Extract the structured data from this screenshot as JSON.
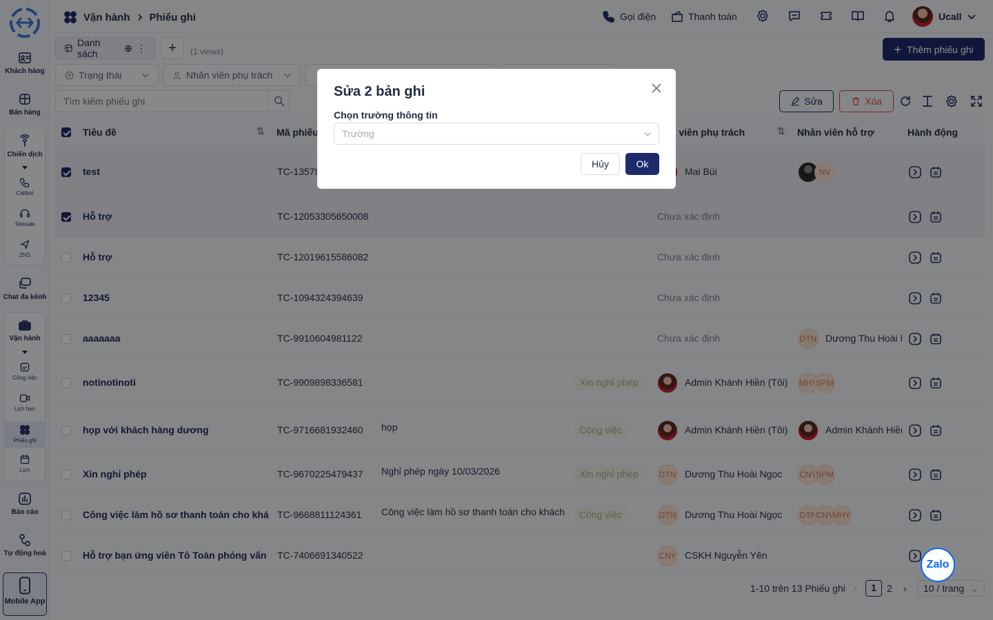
{
  "breadcrumb": {
    "section": "Vận hành",
    "page": "Phiếu ghi"
  },
  "topbar": {
    "call": "Gọi điện",
    "payment": "Thanh toán",
    "user": "Ucall"
  },
  "sidebar": {
    "customers": "Khách hàng",
    "sales": "Bán hàng",
    "campaign": "Chiến dịch",
    "callbot": "Callbot",
    "telesale": "Telesale",
    "zns": "ZNS",
    "chat": "Chat đa kênh",
    "operations": "Vận hành",
    "tasks": "Công việc",
    "appointments": "Lịch hẹn",
    "tickets": "Phiếu ghi",
    "calendar": "Lịch",
    "reports": "Báo cáo",
    "automation": "Tự động hoá",
    "mobile": "Mobile App"
  },
  "toolbar": {
    "view_tab": "Danh sách",
    "views_count": "(1 views)",
    "add_ticket": "Thêm phiếu ghi",
    "edit": "Sửa",
    "delete": "Xóa"
  },
  "filters": {
    "status": "Trạng thái",
    "assignee": "Nhân viên phụ trách",
    "search_placeholder": "Tìm kiếm phiếu ghi"
  },
  "columns": {
    "title": "Tiêu đề",
    "code": "Mã phiếu",
    "assignee": "Nhân viên phụ trách",
    "assignee_partial": "n viên phụ trách",
    "support": "Nhân viên hỗ trợ",
    "actions": "Hành động"
  },
  "rows": [
    {
      "title": "test",
      "code": "TC-13579",
      "desc": "",
      "tag": "",
      "assignee": "Mai Bùi",
      "assignee_badge": "photo",
      "support": [
        {
          "t": "",
          "k": "dark"
        },
        {
          "t": "NV",
          "k": "init"
        }
      ],
      "support_name": "",
      "checked": true
    },
    {
      "title": "Hỗ trợ",
      "code": "TC-12053305650008",
      "desc": "",
      "tag": "",
      "assignee": "Chưa xác định",
      "assignee_badge": "",
      "support": [],
      "support_name": "",
      "checked": true
    },
    {
      "title": "Hỗ trợ",
      "code": "TC-12019615586082",
      "desc": "",
      "tag": "",
      "assignee": "Chưa xác định",
      "assignee_badge": "",
      "support": [],
      "support_name": "",
      "checked": false
    },
    {
      "title": "12345",
      "code": "TC-1094324394639",
      "desc": "",
      "tag": "",
      "assignee": "Chưa xác định",
      "assignee_badge": "",
      "support": [],
      "support_name": "",
      "checked": false
    },
    {
      "title": "aaaaaaa",
      "code": "TC-9910604981122",
      "desc": "",
      "tag": "",
      "assignee": "Chưa xác định",
      "assignee_badge": "",
      "support": [
        {
          "t": "DTN",
          "k": "init"
        }
      ],
      "support_name": "Dương Thu Hoài N",
      "checked": false
    },
    {
      "title": "notinotinoti",
      "code": "TC-9909898336581",
      "desc": "",
      "tag": "Xin nghỉ phép",
      "assignee": "Admin Khánh Hiền (Tôi)",
      "assignee_badge": "photo",
      "support": [
        {
          "t": "MHY",
          "k": "init"
        },
        {
          "t": "SPM",
          "k": "init"
        }
      ],
      "support_name": "",
      "checked": false
    },
    {
      "title": "họp với khách hàng dương",
      "code": "TC-9716681932460",
      "desc": "họp",
      "tag": "Công việc",
      "assignee": "Admin Khánh Hiền (Tôi)",
      "assignee_badge": "photo",
      "support": [
        {
          "t": "",
          "k": "photo"
        }
      ],
      "support_name": "Admin Khánh Hiền",
      "checked": false
    },
    {
      "title": "Xin nghỉ phép",
      "code": "TC-9670225479437",
      "desc": "Nghỉ phép ngày 10/03/2026",
      "tag": "Xin nghỉ phép",
      "assignee": "Dương Thu Hoài Ngọc",
      "assignee_badge": "DTN",
      "support": [
        {
          "t": "CNY",
          "k": "init"
        },
        {
          "t": "SPM",
          "k": "init"
        }
      ],
      "support_name": "",
      "checked": false
    },
    {
      "title": "Công việc làm hồ sơ thanh toán cho khách",
      "code": "TC-9668811124361",
      "desc": "Công việc làm hồ sơ thanh toán cho khách",
      "tag": "Công việc",
      "assignee": "Dương Thu Hoài Ngọc",
      "assignee_badge": "DTN",
      "support": [
        {
          "t": "DTN",
          "k": "init"
        },
        {
          "t": "CNY",
          "k": "init"
        },
        {
          "t": "MHY",
          "k": "init"
        }
      ],
      "support_name": "",
      "checked": false
    },
    {
      "title": "Hỗ trợ bạn ứng viên Tô Toàn phỏng vấn",
      "code": "TC-7406691340522",
      "desc": "",
      "tag": "",
      "assignee": "CSKH Nguyễn Yên",
      "assignee_badge": "CNY",
      "support": [],
      "support_name": "",
      "checked": false
    }
  ],
  "pagination": {
    "summary": "1-10 trên 13 Phiếu ghi",
    "page1": "1",
    "page2": "2",
    "per_page": "10 / trang"
  },
  "modal": {
    "title": "Sửa 2 bản ghi",
    "field_label": "Chọn trường thông tin",
    "field_placeholder": "Trường",
    "cancel": "Hủy",
    "ok": "Ok"
  },
  "zalo": "Zalo",
  "colors": {
    "primary": "#1e2a6b",
    "tag_bg": "#eef3e9",
    "badge_bg": "#f7e0d4"
  }
}
